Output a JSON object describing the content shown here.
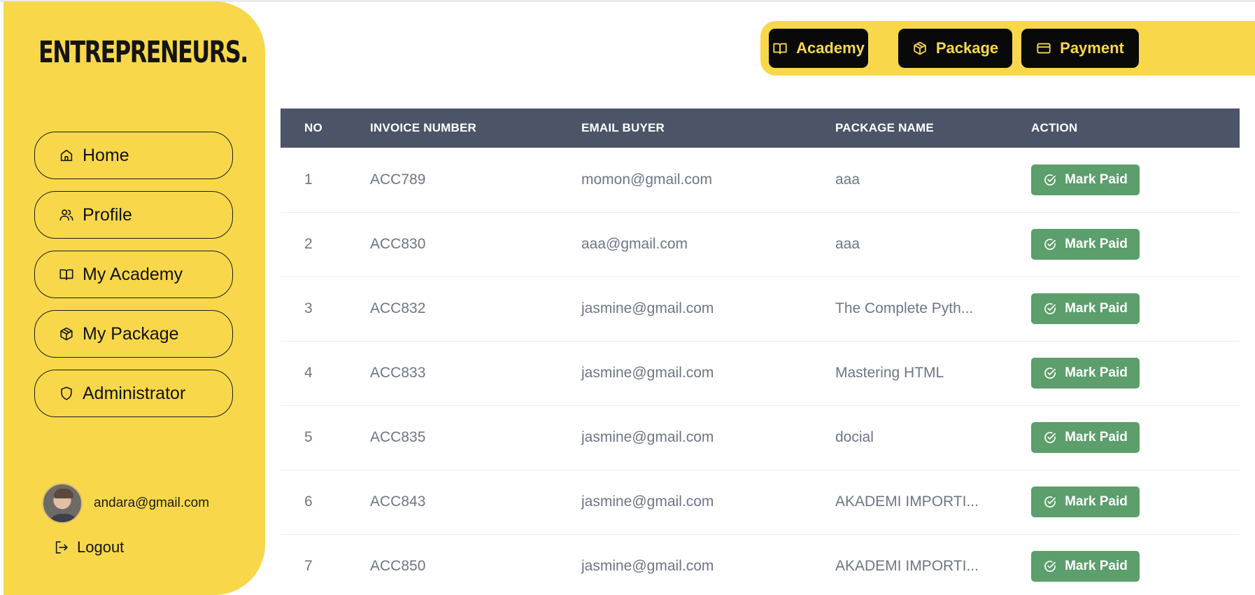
{
  "sidebar": {
    "brand": "ENTREPRENEURS.",
    "items": [
      {
        "label": "Home",
        "icon": "home-icon"
      },
      {
        "label": "Profile",
        "icon": "users-icon"
      },
      {
        "label": "My Academy",
        "icon": "book-icon"
      },
      {
        "label": "My Package",
        "icon": "box-icon"
      },
      {
        "label": "Administrator",
        "icon": "shield-icon"
      }
    ],
    "user_email": "andara@gmail.com",
    "logout_label": "Logout"
  },
  "topnav": {
    "academy_label": "Academy",
    "package_label": "Package",
    "payment_label": "Payment"
  },
  "table": {
    "headers": [
      "NO",
      "INVOICE NUMBER",
      "EMAIL BUYER",
      "PACKAGE NAME",
      "ACTION"
    ],
    "rows": [
      {
        "no": "1",
        "invoice": "ACC789",
        "email": "momon@gmail.com",
        "package": "aaa",
        "action": "Mark Paid"
      },
      {
        "no": "2",
        "invoice": "ACC830",
        "email": "aaa@gmail.com",
        "package": "aaa",
        "action": "Mark Paid"
      },
      {
        "no": "3",
        "invoice": "ACC832",
        "email": "jasmine@gmail.com",
        "package": "The Complete Pyth...",
        "action": "Mark Paid"
      },
      {
        "no": "4",
        "invoice": "ACC833",
        "email": "jasmine@gmail.com",
        "package": "Mastering HTML",
        "action": "Mark Paid"
      },
      {
        "no": "5",
        "invoice": "ACC835",
        "email": "jasmine@gmail.com",
        "package": "docial",
        "action": "Mark Paid"
      },
      {
        "no": "6",
        "invoice": "ACC843",
        "email": "jasmine@gmail.com",
        "package": "AKADEMI IMPORTI...",
        "action": "Mark Paid"
      },
      {
        "no": "7",
        "invoice": "ACC850",
        "email": "jasmine@gmail.com",
        "package": "AKADEMI IMPORTI...",
        "action": "Mark Paid"
      }
    ]
  },
  "colors": {
    "accent_yellow": "#f8d84a",
    "header_gray": "#4b5567",
    "button_green": "#5c9e6c",
    "button_black": "#090909"
  }
}
